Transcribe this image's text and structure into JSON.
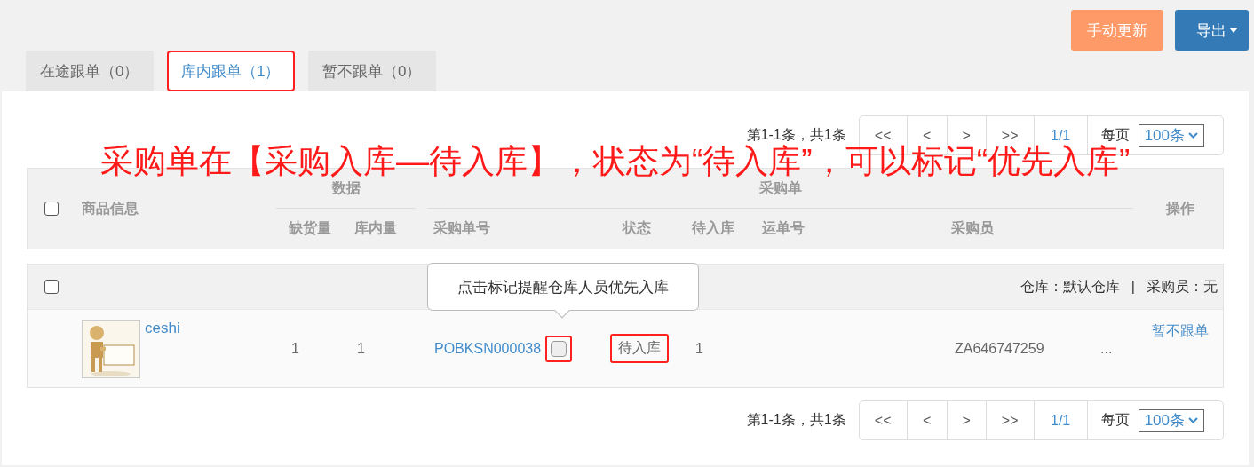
{
  "toolbar": {
    "buttons": [
      {
        "label": "手动更新",
        "kind": "update"
      },
      {
        "label": "导出",
        "kind": "export"
      }
    ]
  },
  "tabs": [
    {
      "label": "在途跟单（0）",
      "selected": false,
      "highlighted": false
    },
    {
      "label": "库内跟单（1）",
      "selected": true,
      "highlighted": true
    },
    {
      "label": "暂不跟单（0）",
      "selected": false,
      "highlighted": false
    }
  ],
  "annotation": "采购单在【采购入库—待入库】，状态为“待入库”，可以标记“优先入库”",
  "paginations": [
    {
      "summary": "第1-1条，共1条",
      "buttons": [
        "<<",
        "<",
        ">",
        ">>"
      ],
      "page": "1/1",
      "per_page_label": "每页",
      "per_page": "100条"
    },
    {
      "summary": "第1-1条，共1条",
      "buttons": [
        "<<",
        "<",
        ">",
        ">>"
      ],
      "page": "1/1",
      "per_page_label": "每页",
      "per_page": "100条"
    }
  ],
  "table": {
    "select_all_checked": false,
    "product_header": "商品信息",
    "data_group": "数据",
    "data_columns": [
      "缺货量",
      "库内量"
    ],
    "order_group": "采购单",
    "order_columns": [
      "采购单号",
      "状态",
      "待入库",
      "运单号",
      "采购员"
    ],
    "action_header": "操作",
    "groups": [
      {
        "checked": false,
        "warehouse": "仓库：默认仓库",
        "separator": "|",
        "buyer": "采购员：无",
        "rows": [
          {
            "product_name": "ceshi",
            "shortage": "1",
            "in_stock": "1",
            "order_no": "POBKSN000038",
            "priority": {
              "checked": false,
              "highlighted": true
            },
            "status": {
              "label": "待入库",
              "highlighted": true
            },
            "pending": "1",
            "tracking_no": "ZA646747259",
            "more": "...",
            "action": "暂不跟单"
          }
        ]
      }
    ]
  },
  "tooltip": {
    "text": "点击标记提醒仓库人员优先入库"
  }
}
